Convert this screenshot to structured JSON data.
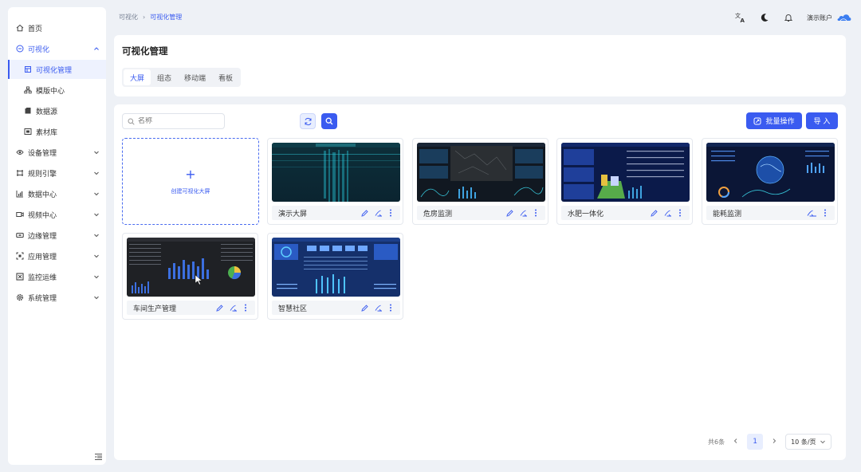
{
  "breadcrumb": [
    "可视化",
    "可视化管理"
  ],
  "header": {
    "account": "演示账户",
    "icons": [
      "translate-icon",
      "moon-icon",
      "bell-icon",
      "cloud-avatar-icon"
    ]
  },
  "sidebar": {
    "items": [
      {
        "label": "首页",
        "icon": "home-icon"
      },
      {
        "label": "可视化",
        "icon": "visual-icon",
        "expanded": true
      },
      {
        "label": "可视化管理",
        "icon": "visual-manage-icon",
        "active": true
      },
      {
        "label": "模版中心",
        "icon": "template-icon"
      },
      {
        "label": "数据源",
        "icon": "database-icon"
      },
      {
        "label": "素材库",
        "icon": "material-icon"
      },
      {
        "label": "设备管理",
        "icon": "device-icon"
      },
      {
        "label": "规则引擎",
        "icon": "rule-icon"
      },
      {
        "label": "数据中心",
        "icon": "data-center-icon"
      },
      {
        "label": "视频中心",
        "icon": "video-icon"
      },
      {
        "label": "边缘管理",
        "icon": "edge-icon"
      },
      {
        "label": "应用管理",
        "icon": "app-icon"
      },
      {
        "label": "监控运维",
        "icon": "monitor-icon"
      },
      {
        "label": "系统管理",
        "icon": "system-icon"
      }
    ]
  },
  "page": {
    "title": "可视化管理",
    "tabs": [
      "大屏",
      "组态",
      "移动端",
      "看板"
    ],
    "active_tab": "大屏"
  },
  "toolbar": {
    "search_placeholder": "名称",
    "batch_label": "批量操作",
    "import_label": "导 入"
  },
  "create_card": {
    "label": "创建可视化大屏"
  },
  "cards": [
    {
      "name": "演示大屏",
      "theme": "teal"
    },
    {
      "name": "危房监测",
      "theme": "map"
    },
    {
      "name": "水肥一体化",
      "theme": "navy"
    },
    {
      "name": "能耗监测",
      "theme": "globe"
    },
    {
      "name": "车间生产管理",
      "theme": "dark"
    },
    {
      "name": "智慧社区",
      "theme": "blue"
    }
  ],
  "pagination": {
    "total": "共6条",
    "current": "1",
    "page_size": "10 条/页"
  },
  "colors": {
    "accent": "#3a5bf0",
    "background": "#eef1f6"
  }
}
